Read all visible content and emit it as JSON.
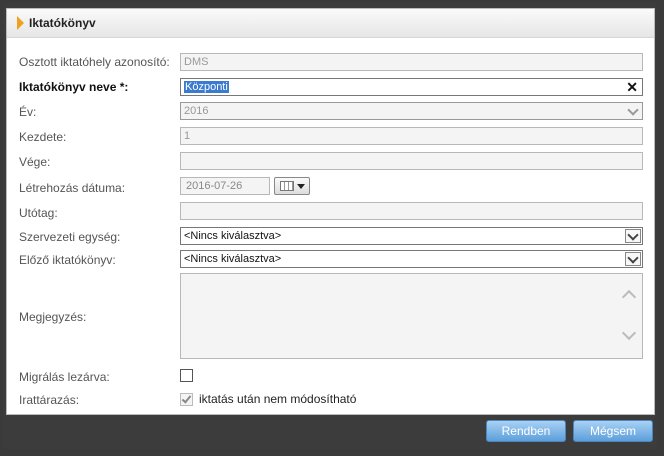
{
  "dialog": {
    "title": "Iktatókönyv",
    "fields": {
      "osztott_label": "Osztott iktatóhely azonosító:",
      "osztott_value": "DMS",
      "nev_label": "Iktatókönyv neve *:",
      "nev_value": "Központi",
      "ev_label": "Év:",
      "ev_value": "2016",
      "kezdete_label": "Kezdete:",
      "kezdete_value": "1",
      "vege_label": "Vége:",
      "vege_value": "",
      "letrehozas_label": "Létrehozás dátuma:",
      "letrehozas_value": "2016-07-26",
      "utotag_label": "Utótag:",
      "utotag_value": "",
      "szervezeti_label": "Szervezeti egység:",
      "szervezeti_value": "<Nincs kiválasztva>",
      "elozo_label": "Előző iktatókönyv:",
      "elozo_value": "<Nincs kiválasztva>",
      "megjegyzes_label": "Megjegyzés:",
      "megjegyzes_value": "",
      "migralas_label": "Migrálás lezárva:",
      "migralas_checked": false,
      "irattarazas_label": "Irattárazás:",
      "irattarazas_option": "iktatás után nem módosítható",
      "irattarazas_checked": true
    }
  },
  "buttons": {
    "ok": "Rendben",
    "cancel": "Mégsem"
  },
  "icons": {
    "title_marker": "triangle-right-icon",
    "clear": "close-icon",
    "dropdown": "chevron-down-icon",
    "calendar": "calendar-icon"
  },
  "colors": {
    "accent": "#f0a020",
    "selection": "#3a7ad0",
    "button": "#5d9fdb"
  }
}
